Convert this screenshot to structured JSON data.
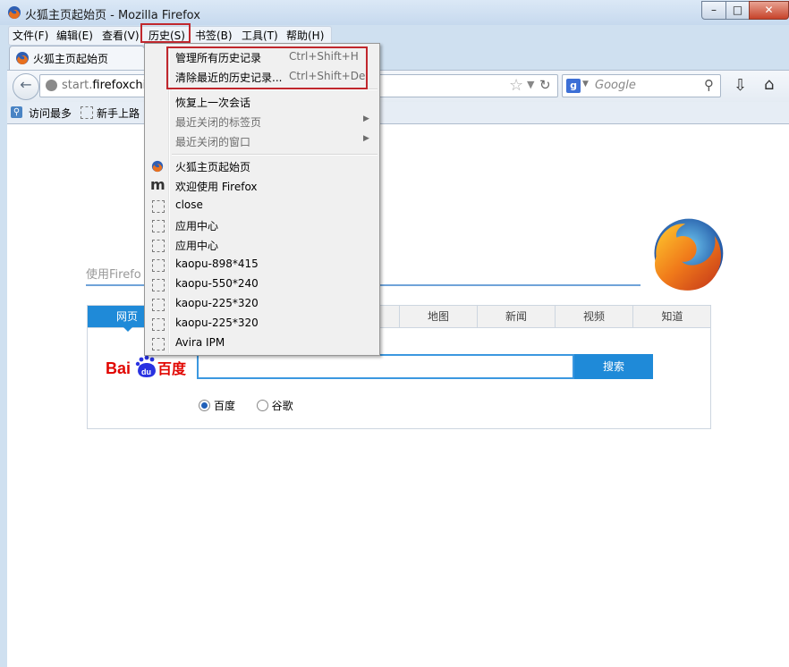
{
  "window": {
    "title": "火狐主页起始页 - Mozilla Firefox",
    "controls": {
      "minimize": "–",
      "maximize": "□",
      "close": "✕"
    }
  },
  "menubar": {
    "items": [
      "文件(F)",
      "编辑(E)",
      "查看(V)",
      "历史(S)",
      "书签(B)",
      "工具(T)",
      "帮助(H)"
    ]
  },
  "tab": {
    "title": "火狐主页起始页"
  },
  "navbar": {
    "url_prefix": "start.",
    "url_domain": "firefoxchina",
    "search_placeholder": "Google",
    "search_engine_letter": "g"
  },
  "bookmarks": {
    "items": [
      "访问最多",
      "新手上路"
    ]
  },
  "history_menu": {
    "manage_label": "管理所有历史记录",
    "manage_shortcut": "Ctrl+Shift+H",
    "clear_label": "清除最近的历史记录...",
    "clear_shortcut": "Ctrl+Shift+Del",
    "restore_label": "恢复上一次会话",
    "closed_tabs_label": "最近关闭的标签页",
    "closed_windows_label": "最近关闭的窗口",
    "entries": [
      "火狐主页起始页",
      "欢迎使用 Firefox",
      "close",
      "应用中心",
      "应用中心",
      "kaopu-898*415",
      "kaopu-550*240",
      "kaopu-225*320",
      "kaopu-225*320",
      "Avira IPM"
    ]
  },
  "page": {
    "hint": "使用Firefo",
    "search_tabs": [
      "网页",
      "地图",
      "新闻",
      "视频",
      "知道"
    ],
    "search_button": "搜索",
    "engine_options": [
      "百度",
      "谷歌"
    ],
    "baidu_logo_text": "Bai百度"
  },
  "colors": {
    "accent": "#1f8ad8",
    "highlight_box": "#c0272d"
  }
}
